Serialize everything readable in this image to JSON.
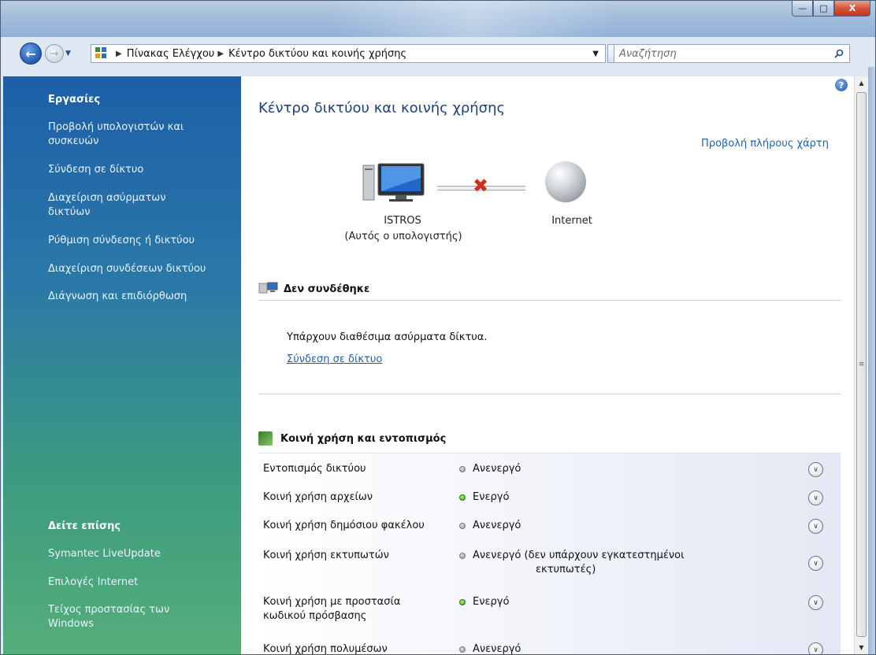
{
  "window": {
    "caption_buttons": {
      "minimize": "—",
      "maximize": "□",
      "close": "X"
    }
  },
  "nav": {
    "back_icon": "back-arrow-icon",
    "forward_icon": "forward-arrow-icon",
    "breadcrumb": [
      "Πίνακας Ελέγχου",
      "Κέντρο δικτύου και κοινής χρήσης"
    ],
    "search_placeholder": "Αναζήτηση"
  },
  "sidebar": {
    "tasks_title": "Εργασίες",
    "tasks": [
      "Προβολή υπολογιστών και συσκευών",
      "Σύνδεση σε δίκτυο",
      "Διαχείριση ασύρματων δικτύων",
      "Ρύθμιση σύνδεσης ή δικτύου",
      "Διαχείριση συνδέσεων δικτύου",
      "Διάγνωση και επιδιόρθωση"
    ],
    "see_also_title": "Δείτε επίσης",
    "see_also": [
      "Symantec LiveUpdate",
      "Επιλογές Internet",
      "Τείχος προστασίας των Windows"
    ]
  },
  "main": {
    "title": "Κέντρο δικτύου και κοινής χρήσης",
    "full_map_link": "Προβολή πλήρους χάρτη",
    "computer_name": "ISTROS",
    "computer_sub": "(Αυτός ο υπολογιστής)",
    "internet_label": "Internet",
    "not_connected_heading": "Δεν συνδέθηκε",
    "available_networks": "Υπάρχουν διαθέσιμα ασύρματα δίκτυα.",
    "connect_link": "Σύνδεση σε δίκτυο",
    "sharing_heading": "Κοινή χρήση και εντοπισμός",
    "sharing_rows": [
      {
        "label": "Εντοπισμός δικτύου",
        "status": "Ανενεργό",
        "state": "off"
      },
      {
        "label": "Κοινή χρήση αρχείων",
        "status": "Ενεργό",
        "state": "on"
      },
      {
        "label": "Κοινή χρήση δημόσιου φακέλου",
        "status": "Ανενεργό",
        "state": "off"
      },
      {
        "label": "Κοινή χρήση εκτυπωτών",
        "status": "Ανενεργό (δεν υπάρχουν εγκατεστημένοι",
        "status_line2": "εκτυπωτές)",
        "state": "off"
      },
      {
        "label": "Κοινή χρήση με προστασία κωδικού πρόσβασης",
        "status": "Ενεργό",
        "state": "on"
      },
      {
        "label": "Κοινή χρήση πολυμέσων",
        "status": "Ανενεργό",
        "state": "off"
      }
    ]
  },
  "colors": {
    "link": "#1e5fb5",
    "title": "#1e3f7a",
    "status_on": "#2f9e14",
    "status_off": "#8f8f8f",
    "error_x": "#d72b1e"
  }
}
